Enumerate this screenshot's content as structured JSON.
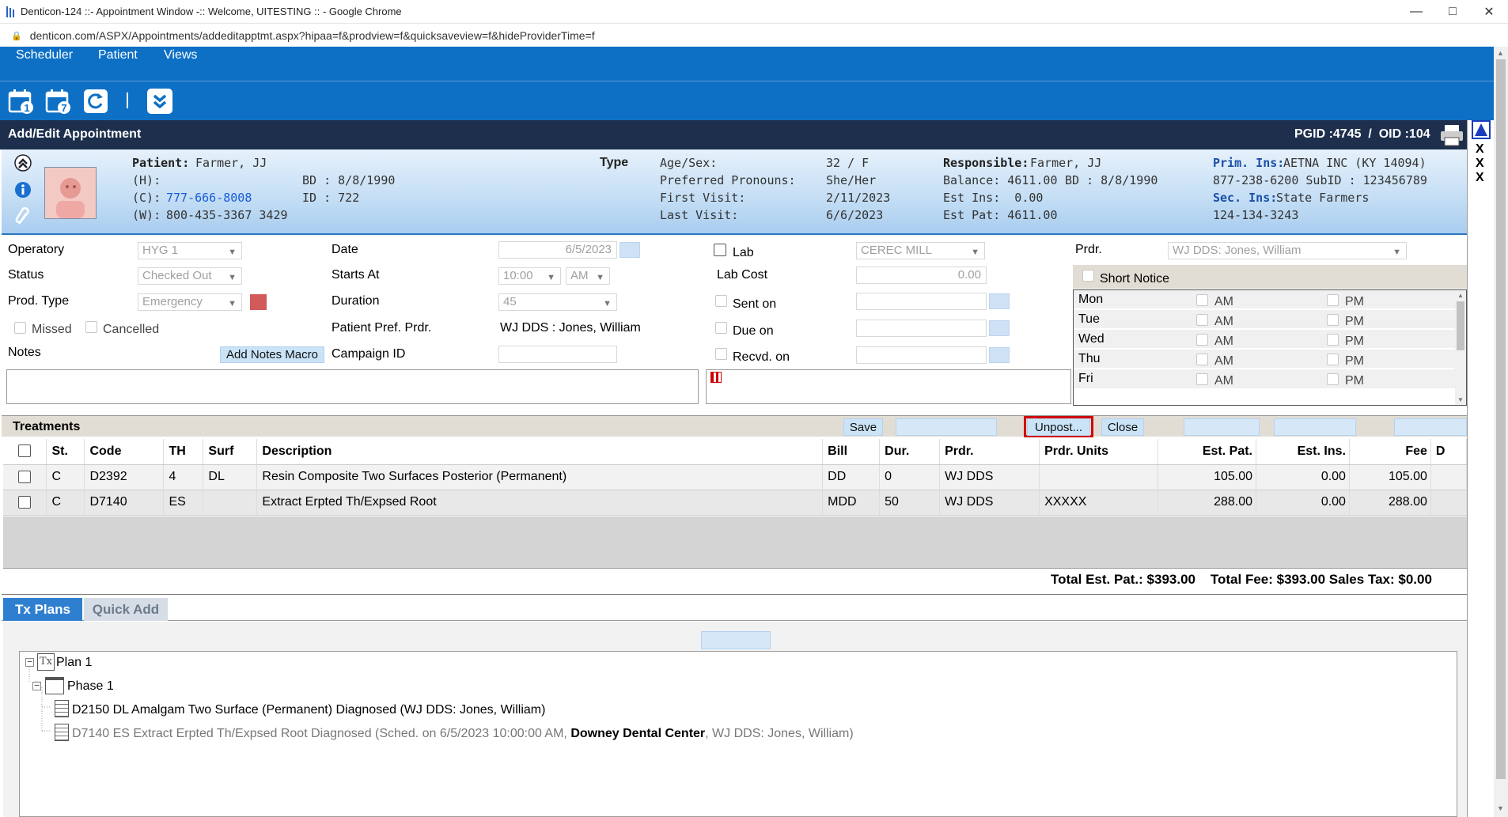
{
  "window": {
    "title": "Denticon-124 ::- Appointment Window -:: Welcome, UITESTING :: - Google Chrome",
    "url": "denticon.com/ASPX/Appointments/addeditapptmt.aspx?hipaa=f&prodview=f&quicksaveview=f&hideProviderTime=f"
  },
  "menu": {
    "scheduler": "Scheduler",
    "patient": "Patient",
    "views": "Views"
  },
  "header": {
    "title": "Add/Edit Appointment",
    "ids": "PGID :4745  /  OID :104"
  },
  "patient": {
    "patient_label": "Patient:",
    "patient_name": "Farmer, JJ",
    "h_label": "(H):",
    "c_label": "(C):",
    "c_phone": "777-666-8008",
    "w_label": "(W):",
    "w_phone": "800-435-3367 3429",
    "bd": "BD : 8/8/1990",
    "id": "ID : 722",
    "type_label": "Type",
    "age_label": "Age/Sex:",
    "age_value": "32 / F",
    "pronoun_label": "Preferred Pronouns:",
    "pronoun_value": "She/Her",
    "first_label": "First Visit:",
    "first_value": "2/11/2023",
    "last_label": "Last Visit:",
    "last_value": "6/6/2023",
    "resp_label": "Responsible:",
    "resp_value": "Farmer, JJ",
    "balance": "Balance: 4611.00",
    "resp_bd": "BD : 8/8/1990",
    "est_ins": "Est Ins:  0.00",
    "est_pat": "Est Pat: 4611.00",
    "prim_label": "Prim. Ins:",
    "prim_value": "AETNA INC (KY 14094)",
    "prim_phone": "877-238-6200 SubID : 123456789",
    "sec_label": "Sec. Ins:",
    "sec_value": "State Farmers",
    "sec_phone": "124-134-3243"
  },
  "form": {
    "operatory_label": "Operatory",
    "operatory_value": "HYG 1",
    "status_label": "Status",
    "status_value": "Checked Out",
    "prodtype_label": "Prod. Type",
    "prodtype_value": "Emergency",
    "missed": "Missed",
    "cancelled": "Cancelled",
    "notes_label": "Notes",
    "notes_macro": "Add Notes Macro",
    "date_label": "Date",
    "date_value": "6/5/2023",
    "starts_label": "Starts At",
    "starts_time": "10:00",
    "starts_ampm": "AM",
    "duration_label": "Duration",
    "duration_value": "45",
    "pref_label": "Patient Pref. Prdr.",
    "pref_value": "WJ DDS : Jones, William",
    "campaign_label": "Campaign ID",
    "lab_label": "Lab",
    "lab_value": "CEREC MILL",
    "labcost_label": "Lab Cost",
    "labcost_value": "0.00",
    "senton_label": "Sent on",
    "dueon_label": "Due on",
    "recvd_label": "Recvd. on",
    "prdr_label": "Prdr.",
    "prdr_value": "WJ DDS: Jones, William",
    "short_notice": "Short Notice",
    "days": [
      "Mon",
      "Tue",
      "Wed",
      "Thu",
      "Fri"
    ],
    "am": "AM",
    "pm": "PM"
  },
  "treatments": {
    "title": "Treatments",
    "save": "Save",
    "unpost": "Unpost...",
    "close": "Close",
    "columns": [
      "St.",
      "Code",
      "TH",
      "Surf",
      "Description",
      "Bill",
      "Dur.",
      "Prdr.",
      "Prdr. Units",
      "Est. Pat.",
      "Est. Ins.",
      "Fee",
      "D"
    ],
    "rows": [
      {
        "st": "C",
        "code": "D2392",
        "th": "4",
        "surf": "DL",
        "desc": "Resin Composite Two Surfaces Posterior (Permanent)",
        "bill": "DD",
        "dur": "0",
        "prdr": "WJ DDS",
        "units": "",
        "estpat": "105.00",
        "estins": "0.00",
        "fee": "105.00"
      },
      {
        "st": "C",
        "code": "D7140",
        "th": "ES",
        "surf": "",
        "desc": "Extract Erpted Th/Expsed Root",
        "bill": "MDD",
        "dur": "50",
        "prdr": "WJ DDS",
        "units": "XXXXX",
        "estpat": "288.00",
        "estins": "0.00",
        "fee": "288.00"
      }
    ],
    "totals": "Total Est. Pat.: $393.00    Total Fee: $393.00 Sales Tax: $0.00"
  },
  "tabs": {
    "txplans": "Tx Plans",
    "quickadd": "Quick Add"
  },
  "tree": {
    "plan": "Plan 1",
    "phase": "Phase 1",
    "item1": "D2150 DL Amalgam Two Surface (Permanent) Diagnosed (WJ DDS: Jones, William)",
    "item2_a": "D7140 ES Extract Erpted Th/Expsed Root Diagnosed (Sched. on 6/5/2023 10:00:00 AM, ",
    "item2_b": "Downey Dental Center",
    "item2_c": ", WJ DDS: Jones, William)"
  }
}
